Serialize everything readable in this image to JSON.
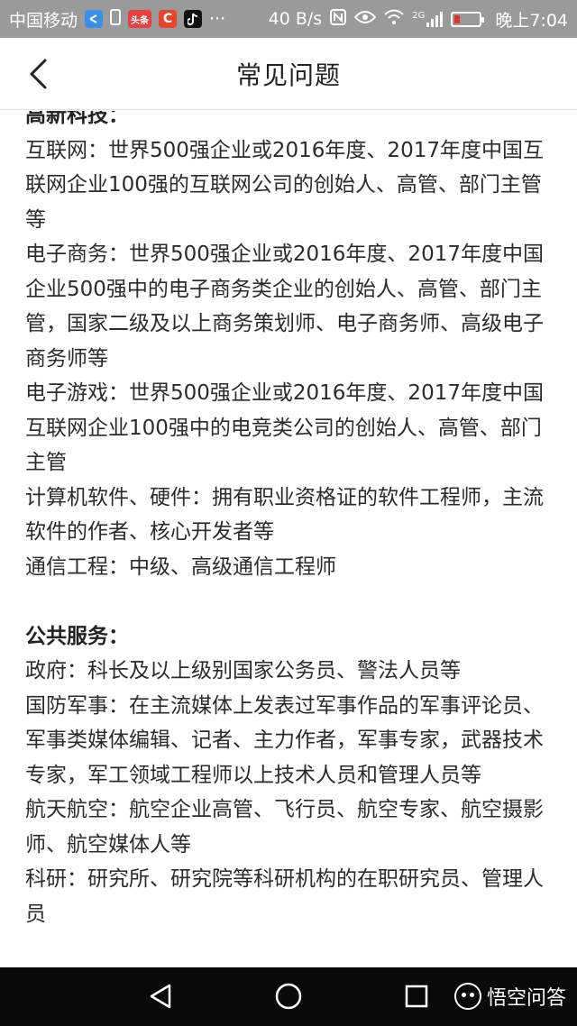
{
  "status_bar": {
    "carrier": "中国移动",
    "network_speed": "40 B/s",
    "network_type": "2G",
    "time": "晚上7:04",
    "icons": [
      "share-icon",
      "sim-icon",
      "toutiao-icon",
      "c-app-icon",
      "tiktok-icon",
      "more-icon",
      "nfc-icon",
      "eye-icon",
      "wifi-icon",
      "signal-icon",
      "battery-icon"
    ],
    "app_badge_toutiao": "头条",
    "app_badge_c": "C",
    "more_dots": "···"
  },
  "header": {
    "title": "常见问题",
    "back_icon": "chevron-left-icon"
  },
  "sections": [
    {
      "title": "高新科技：",
      "entries": [
        "互联网：世界500强企业或2016年度、2017年度中国互联网企业100强的互联网公司的创始人、高管、部门主管等",
        "电子商务：世界500强企业或2016年度、2017年度中国企业500强中的电子商务类企业的创始人、高管、部门主管，国家二级及以上商务策划师、电子商务师、高级电子商务师等",
        "电子游戏：世界500强企业或2016年度、2017年度中国互联网企业100强中的电竞类公司的创始人、高管、部门主管",
        "计算机软件、硬件：拥有职业资格证的软件工程师，主流软件的作者、核心开发者等",
        "通信工程：中级、高级通信工程师"
      ]
    },
    {
      "title": "公共服务：",
      "entries": [
        "政府：科长及以上级别国家公务员、警法人员等",
        "国防军事：在主流媒体上发表过军事作品的军事评论员、军事类媒体编辑、记者、主力作者，军事专家，武器技术专家，军工领域工程师以上技术人员和管理人员等",
        "航天航空：航空企业高管、飞行员、航空专家、航空摄影师、航空媒体人等",
        "科研：研究所、研究院等科研机构的在职研究员、管理人员"
      ]
    }
  ],
  "nav_bar": {
    "back_icon": "triangle-back-icon",
    "home_icon": "circle-home-icon",
    "recent_icon": "square-recent-icon",
    "watermark_text": "悟空问答",
    "watermark_icon": "wukong-logo-icon"
  },
  "colors": {
    "status_bar_bg": "#9a9a9a",
    "nav_bar_bg": "#0a0a0a",
    "battery_low": "#e0332b",
    "text": "#2b2b2b"
  }
}
